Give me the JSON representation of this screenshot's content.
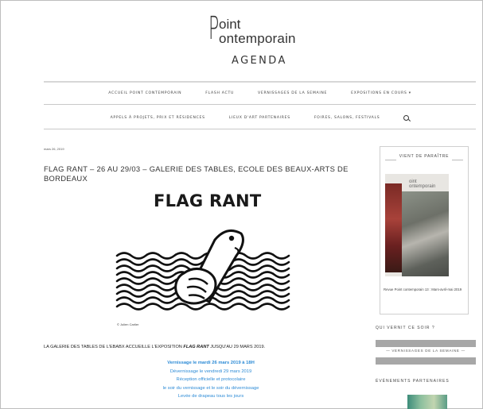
{
  "logo": {
    "line1": "oint",
    "line2": "ontemporain",
    "subtitle": "AGENDA",
    "initial": "P"
  },
  "nav": {
    "row1": [
      "ACCUEIL POINT CONTEMPORAIN",
      "FLASH ACTU",
      "VERNISSAGES DE LA SEMAINE",
      "EXPOSITIONS EN COURS ▾"
    ],
    "row2": [
      "APPELS À PROJETS, PRIX ET RÉSIDENCES",
      "LIEUX D'ART PARTENAIRES",
      "FOIRES, SALONS, FESTIVALS"
    ],
    "search_icon": "search-icon"
  },
  "article": {
    "date": "mars 26, 2019",
    "title": "FLAG RANT – 26 AU 29/03 – GALERIE DES TABLES, ECOLE DES BEAUX-ARTS DE BORDEAUX",
    "heading": "FLAG RANT",
    "credit": "© Julien Carlier",
    "intro_before": "LA GALERIE DES TABLES DE L'EBABX ACCUEILLE L'EXPOSITION ",
    "intro_bold": "FLAG RANT",
    "intro_after": " JUSQU'AU 29 MARS 2019.",
    "blue_lines": [
      "Vernissage le mardi 26 mars 2019 à 18H",
      "Dévernissage le vendredi 29 mars 2019",
      "Réception officielle et protocolaire",
      "le soir du vernissage et le soir du dévernissage",
      "Levée de drapeau tous les jours"
    ],
    "blue_color": "#2d8bd6"
  },
  "sidebar": {
    "vient_de_paraitre": "VIENT DE PARAÎTRE",
    "cover_logo_line1": "oint",
    "cover_logo_line2": "ontemporain",
    "cover_caption": "Revue Point contemporain 13 : Mars-avril-mai 2019",
    "qui_vernit": "QUI VERNIT CE SOIR ?",
    "vernissages_link": "— VERNISSAGES DE LA SEMAINE —",
    "evenements": "ÉVÉNEMENTS PARTENAIRES"
  }
}
